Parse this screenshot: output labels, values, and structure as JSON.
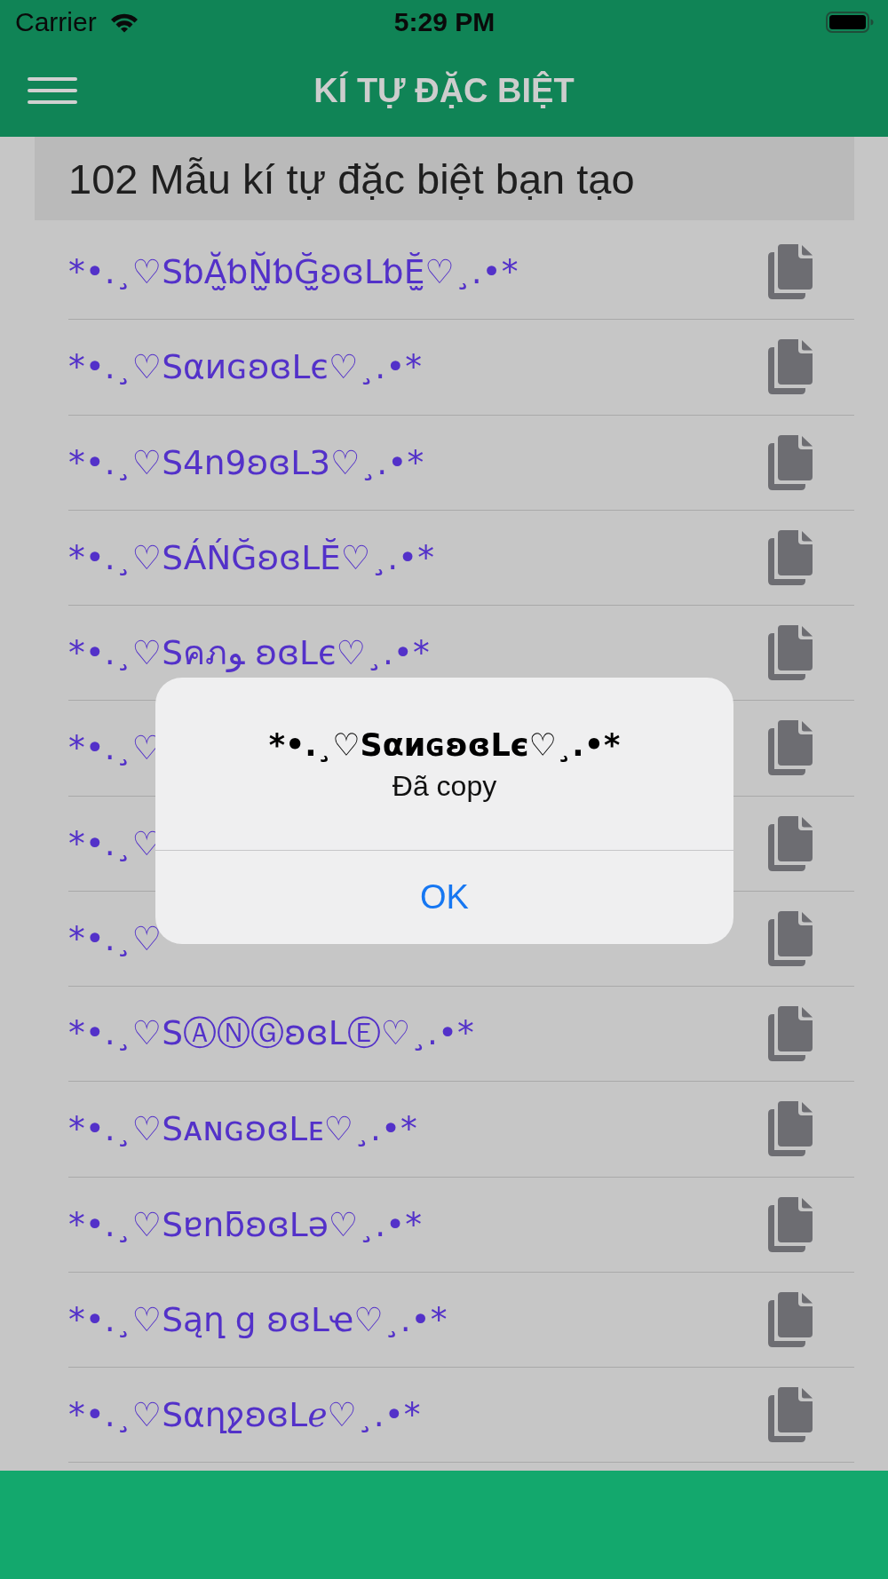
{
  "status_bar": {
    "carrier": "Carrier",
    "time": "5:29 PM"
  },
  "nav_bar": {
    "title": "KÍ TỰ ĐẶC BIỆT"
  },
  "list_header": "102 Mẫu kí tự đặc biệt bạn tạo",
  "items": [
    {
      "text": "*•.¸♡SƅĂ̫ƅN̫̆ƅĞ̫ʚɞLƅĔ̫♡¸.•*"
    },
    {
      "text": "*•.¸♡SαиɢʚɞLє♡¸.•*"
    },
    {
      "text": "*•.¸♡S4n9ʚɞL3♡¸.•*"
    },
    {
      "text": "*•.¸♡SÁŃĞʚɞLĔ♡¸.•*"
    },
    {
      "text": "*•.¸♡Sคภﻮ ʚɞLє♡¸.•*"
    },
    {
      "text": "*•.¸♡"
    },
    {
      "text": "*•.¸♡"
    },
    {
      "text": "*•.¸♡"
    },
    {
      "text": "*•.¸♡SⒶⓃⒼʚɞLⒺ♡¸.•*"
    },
    {
      "text": "*•.¸♡SᴀɴɢʚɞLᴇ♡¸.•*"
    },
    {
      "text": "*•.¸♡SɐnƃʚɞLǝ♡¸.•*"
    },
    {
      "text": "*•.¸♡Sąղ ց ʚɞLҽ♡¸.•*"
    },
    {
      "text": "*•.¸♡SαղջʚɞLℯ♡¸.•*"
    }
  ],
  "alert": {
    "title": "*•.¸♡SαиɢʚɞLє♡¸.•*",
    "message": "Đã copy",
    "buttons": [
      "OK"
    ]
  }
}
